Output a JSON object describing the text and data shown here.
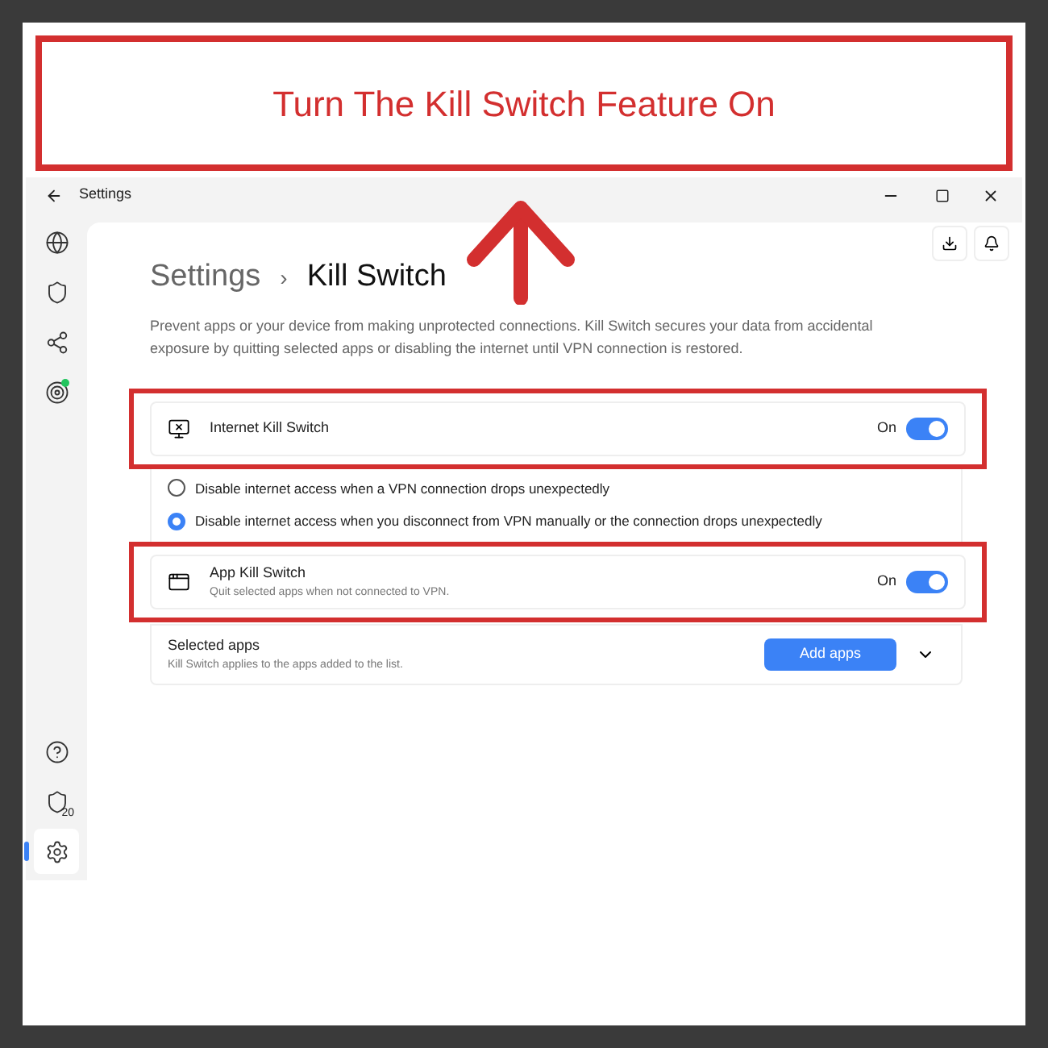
{
  "banner": {
    "title": "Turn The Kill Switch Feature On"
  },
  "window": {
    "title": "Settings"
  },
  "sidebar": {
    "top_items": [
      {
        "kind": "globe",
        "selected": false
      },
      {
        "kind": "shield",
        "selected": false
      },
      {
        "kind": "nodes",
        "selected": false
      },
      {
        "kind": "target",
        "selected": false
      }
    ],
    "bottom_items": [
      {
        "kind": "help",
        "selected": false
      },
      {
        "kind": "shield-count",
        "badge": "20",
        "selected": false
      },
      {
        "kind": "gear",
        "selected": true
      }
    ]
  },
  "breadcrumb": {
    "parent": "Settings",
    "separator": "›",
    "current": "Kill Switch"
  },
  "description": "Prevent apps or your device from making unprotected connections. Kill Switch secures your data from accidental exposure by quitting selected apps or disabling the internet until VPN connection is restored.",
  "internet_kill_switch": {
    "label": "Internet Kill Switch",
    "state_label": "On",
    "on": true,
    "highlighted": true
  },
  "options": [
    {
      "label": "Disable internet access when a VPN connection drops unexpectedly",
      "selected": false
    },
    {
      "label": "Disable internet access when you disconnect from VPN manually or the connection drops unexpectedly",
      "selected": true
    }
  ],
  "app_kill_switch": {
    "label": "App Kill Switch",
    "subtitle": "Quit selected apps when not connected to VPN.",
    "state_label": "On",
    "on": true,
    "highlighted": true
  },
  "selected_apps": {
    "label": "Selected apps",
    "subtitle": "Kill Switch applies to the apps added to the list.",
    "button": "Add apps"
  }
}
